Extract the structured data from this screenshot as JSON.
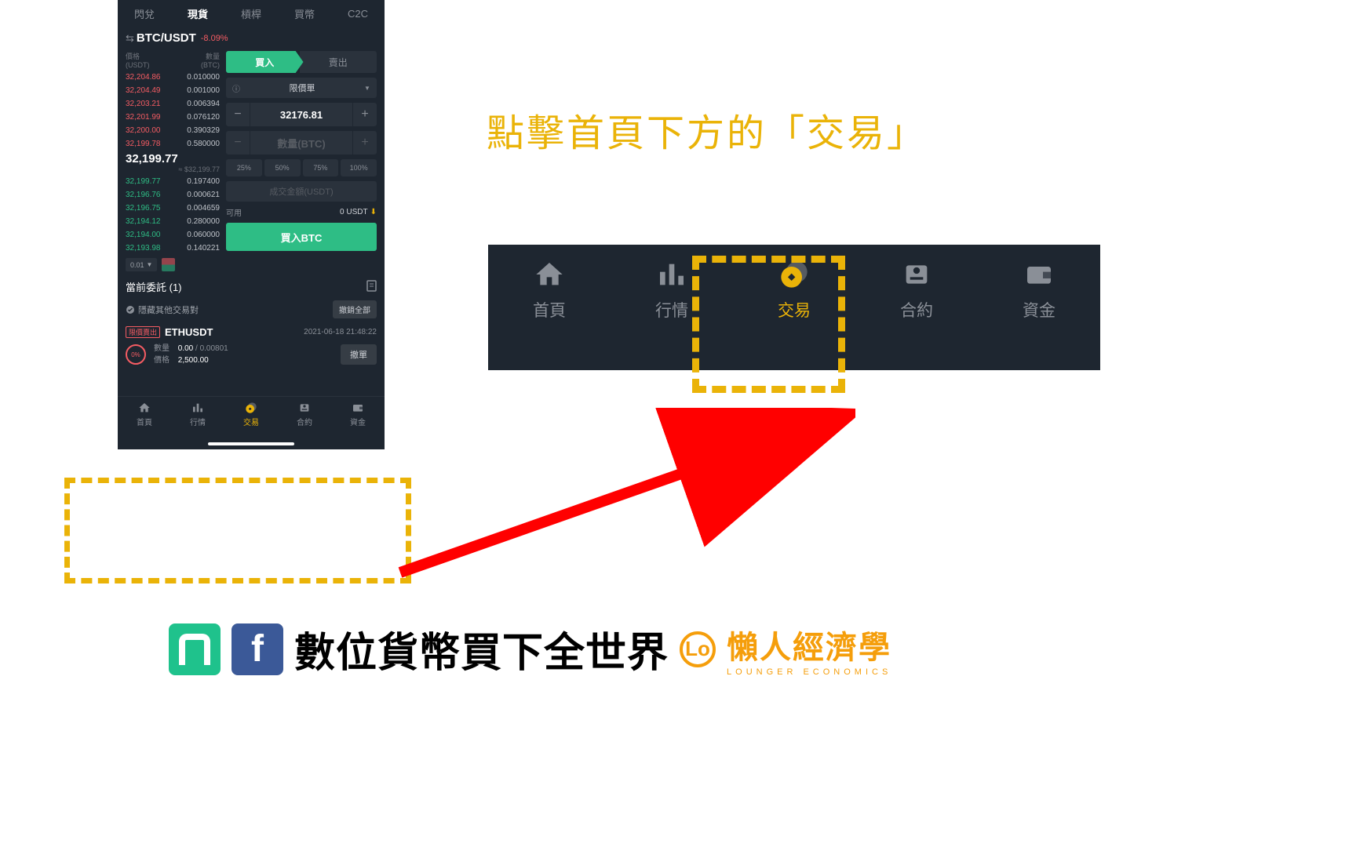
{
  "caption_text": "點擊首頁下方的「交易」",
  "tabs": {
    "t1": "閃兌",
    "t2": "現貨",
    "t3": "槓桿",
    "t4": "買幣",
    "t5": "C2C"
  },
  "header": {
    "swap_glyph": "⇆",
    "pair": "BTC/USDT",
    "change": "-8.09%",
    "chart_icon": "chart-candles",
    "dollar_icon": "dollar-circle",
    "more_icon": "more"
  },
  "orderbook": {
    "price_label": "價格",
    "price_unit": "(USDT)",
    "qty_label": "數量",
    "qty_unit": "(BTC)",
    "asks": [
      {
        "p": "32,204.86",
        "q": "0.010000"
      },
      {
        "p": "32,204.49",
        "q": "0.001000"
      },
      {
        "p": "32,203.21",
        "q": "0.006394"
      },
      {
        "p": "32,201.99",
        "q": "0.076120"
      },
      {
        "p": "32,200.00",
        "q": "0.390329"
      },
      {
        "p": "32,199.78",
        "q": "0.580000"
      }
    ],
    "last": "32,199.77",
    "usd": "≈ $32,199.77",
    "bids": [
      {
        "p": "32,199.77",
        "q": "0.197400"
      },
      {
        "p": "32,196.76",
        "q": "0.000621"
      },
      {
        "p": "32,196.75",
        "q": "0.004659"
      },
      {
        "p": "32,194.12",
        "q": "0.280000"
      },
      {
        "p": "32,194.00",
        "q": "0.060000"
      },
      {
        "p": "32,193.98",
        "q": "0.140221"
      }
    ],
    "depth_sel": "0.01"
  },
  "form": {
    "buy_label": "買入",
    "sell_label": "賣出",
    "order_type": "限價單",
    "info_glyph": "ⓘ",
    "price_value": "32176.81",
    "qty_placeholder": "數量(BTC)",
    "pcts": [
      "25%",
      "50%",
      "75%",
      "100%"
    ],
    "cost_placeholder": "成交金額(USDT)",
    "avail_label": "可用",
    "avail_value": "0 USDT",
    "submit": "買入BTC"
  },
  "orders": {
    "title": "當前委託 (1)",
    "hide_label": "隱藏其他交易對",
    "cancel_all": "撤銷全部",
    "item": {
      "tag": "限價賣出",
      "sym": "ETHUSDT",
      "time": "2021-06-18 21:48:22",
      "pct": "0%",
      "qty_label": "數量",
      "qty_value": "0.00",
      "qty_sep": " / ",
      "qty_total": "0.00801",
      "price_label": "價格",
      "price_value": "2,500.00",
      "cancel": "撤單"
    }
  },
  "nav": {
    "home": "首頁",
    "market": "行情",
    "trade": "交易",
    "futures": "合約",
    "wallet": "資金"
  },
  "footer": {
    "facebook_glyph": "f",
    "brand1": "數位貨幣買下全世界",
    "brand2_glyph": "Lo",
    "brand2_cn": "懶人經濟學",
    "brand2_en": "LOUNGER ECONOMICS"
  }
}
